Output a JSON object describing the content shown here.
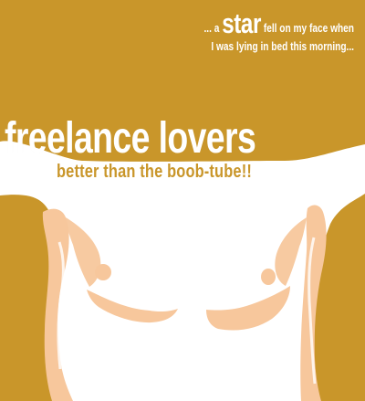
{
  "poster": {
    "tagline": {
      "prefix": "... a",
      "emphasis": "star",
      "suffix": "fell on my face when",
      "line2": "I was lying in bed this morning..."
    },
    "title": "freelance lovers",
    "subtitle": "better than the boob-tube!!"
  },
  "colors": {
    "background": "#c9962a",
    "text": "#ffffff",
    "skin": "#f7c79c",
    "subtitle": "#c9962a"
  }
}
